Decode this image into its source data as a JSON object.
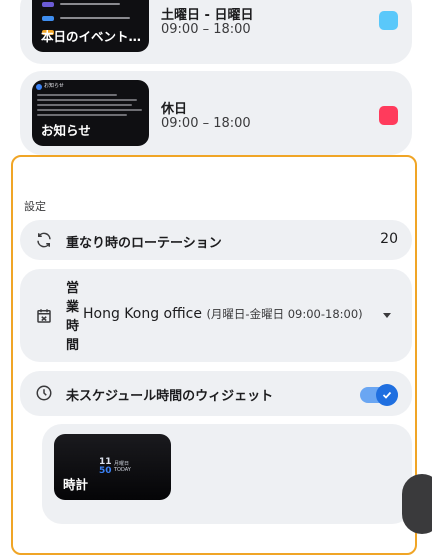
{
  "events": [
    {
      "thumb_label": "本日のイベント…",
      "title": "土曜日 - 日曜日",
      "time": "09:00 – 18:00",
      "color": "#5ac8fa"
    },
    {
      "thumb_label": "お知らせ",
      "thumb_heading": "お知らせ",
      "title": "休日",
      "time": "09:00 – 18:00",
      "color": "#ff3b5c"
    }
  ],
  "settings": {
    "section_label": "設定",
    "rotation": {
      "label": "重なり時のローテーション",
      "value": "20"
    },
    "business_hours": {
      "label": "営業時間",
      "office": "Hong Kong office",
      "hours": "(月曜日-金曜日 09:00-18:00)"
    },
    "unscheduled": {
      "label": "未スケジュール時間のウィジェット",
      "enabled": true
    },
    "widget": {
      "label": "時計",
      "time_hour": "11",
      "time_min": "50",
      "date_line1": "月曜日",
      "date_line2": "TODAY"
    }
  },
  "colors": {
    "highlight_border": "#f0a526",
    "toggle_on": "#1f6fe0"
  }
}
